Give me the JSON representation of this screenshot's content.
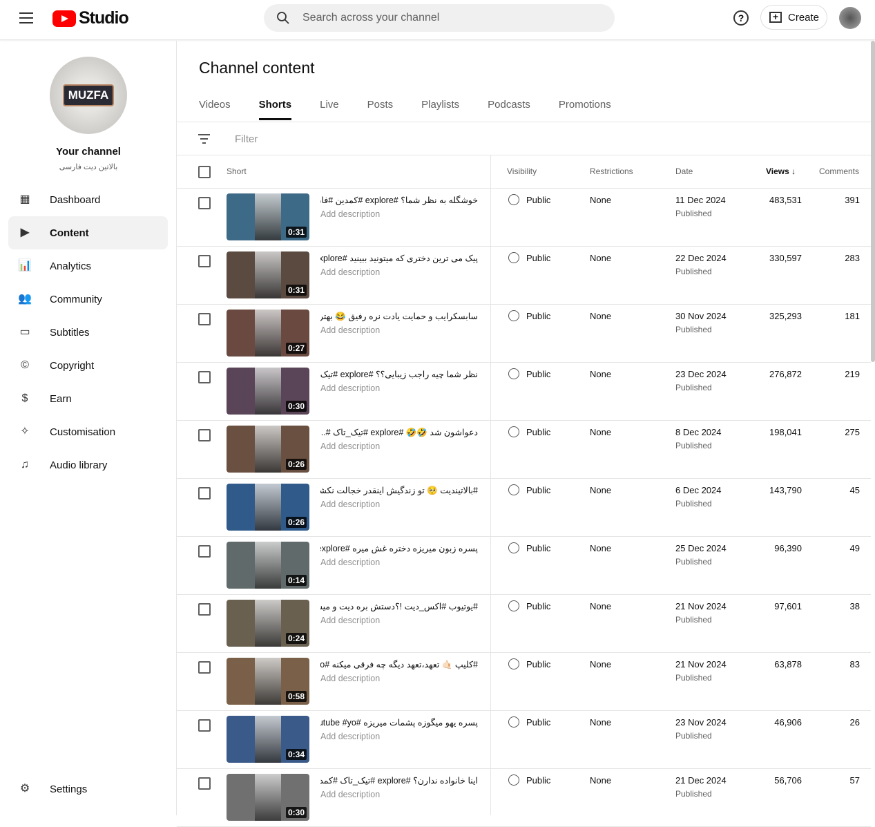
{
  "header": {
    "logo_text": "Studio",
    "search_placeholder": "Search across your channel",
    "help_label": "?",
    "create_label": "Create"
  },
  "sidebar": {
    "channel_title": "Your channel",
    "channel_name": "بالاتین دیت فارسی",
    "avatar_text": "MUZFA",
    "items": [
      {
        "label": "Dashboard",
        "icon": "dashboard-icon",
        "glyph": "▦"
      },
      {
        "label": "Content",
        "icon": "content-icon",
        "glyph": "▶",
        "active": true
      },
      {
        "label": "Analytics",
        "icon": "analytics-icon",
        "glyph": "📊"
      },
      {
        "label": "Community",
        "icon": "community-icon",
        "glyph": "👥"
      },
      {
        "label": "Subtitles",
        "icon": "subtitles-icon",
        "glyph": "▭"
      },
      {
        "label": "Copyright",
        "icon": "copyright-icon",
        "glyph": "©"
      },
      {
        "label": "Earn",
        "icon": "earn-icon",
        "glyph": "$"
      },
      {
        "label": "Customisation",
        "icon": "magic-wand-icon",
        "glyph": "✧"
      },
      {
        "label": "Audio library",
        "icon": "audio-library-icon",
        "glyph": "♫"
      }
    ],
    "settings_label": "Settings"
  },
  "main": {
    "title": "Channel content",
    "tabs": [
      "Videos",
      "Shorts",
      "Live",
      "Posts",
      "Playlists",
      "Podcasts",
      "Promotions"
    ],
    "active_tab": "Shorts",
    "filter_placeholder": "Filter",
    "columns": {
      "short": "Short",
      "visibility": "Visibility",
      "restrictions": "Restrictions",
      "date": "Date",
      "views": "Views",
      "views_sort": "↓",
      "comments": "Comments"
    },
    "rows": [
      {
        "title": "خوشگله به نظر شما؟ #explore #کمدین #فان ...",
        "duration": "0:31",
        "visibility": "Public",
        "restrictions": "None",
        "date": "11 Dec 2024",
        "status": "Published",
        "views": "483,531",
        "comments": "391",
        "color": "#3d6a86"
      },
      {
        "title": "پیک می ترین دختری که میتونید ببینید #explore ...",
        "duration": "0:31",
        "visibility": "Public",
        "restrictions": "None",
        "date": "22 Dec 2024",
        "status": "Published",
        "views": "330,597",
        "comments": "283",
        "color": "#5a4a40"
      },
      {
        "title": "سابسکرایب و حمایت یادت نره رفیق 😂 بهتر بود؟ ...",
        "duration": "0:27",
        "visibility": "Public",
        "restrictions": "None",
        "date": "30 Nov 2024",
        "status": "Published",
        "views": "325,293",
        "comments": "181",
        "color": "#6a4a40"
      },
      {
        "title": "نظر شما چیه راجب زیبایی؟؟ #explore #تیک_تاک...",
        "duration": "0:30",
        "visibility": "Public",
        "restrictions": "None",
        "date": "23 Dec 2024",
        "status": "Published",
        "views": "276,872",
        "comments": "219",
        "color": "#5a4458"
      },
      {
        "title": "دعواشون شد 🤣🤣 #explore #تیک_تاک #...",
        "duration": "0:26",
        "visibility": "Public",
        "restrictions": "None",
        "date": "8 Dec 2024",
        "status": "Published",
        "views": "198,041",
        "comments": "275",
        "color": "#6a5040"
      },
      {
        "title": "#بالاتیندیت 🥺 تو زندگیش اینقدر خجالت نکشیده بود...",
        "duration": "0:26",
        "visibility": "Public",
        "restrictions": "None",
        "date": "6 Dec 2024",
        "status": "Published",
        "views": "143,790",
        "comments": "45",
        "color": "#2f5a8a"
      },
      {
        "title": "پسره زبون میریزه دختره غش میره #explore #...",
        "duration": "0:14",
        "visibility": "Public",
        "restrictions": "None",
        "date": "25 Dec 2024",
        "status": "Published",
        "views": "96,390",
        "comments": "49",
        "color": "#606a6a"
      },
      {
        "title": "#یوتیوب #اکس_دیت !؟دستش بره دیت و میشه بخشید...",
        "duration": "0:24",
        "visibility": "Public",
        "restrictions": "None",
        "date": "21 Nov 2024",
        "status": "Published",
        "views": "97,601",
        "comments": "38",
        "color": "#6a6050"
      },
      {
        "title": "#کلیپ 🤙🏻 تعهد،تعهد دیگه چه فرقی میکنه #explo...",
        "duration": "0:58",
        "visibility": "Public",
        "restrictions": "None",
        "date": "21 Nov 2024",
        "status": "Published",
        "views": "63,878",
        "comments": "83",
        "color": "#7a6048"
      },
      {
        "title": "پسره یهو میگوزه پشمات میریزه #youtube #yo...",
        "duration": "0:34",
        "visibility": "Public",
        "restrictions": "None",
        "date": "23 Nov 2024",
        "status": "Published",
        "views": "46,906",
        "comments": "26",
        "color": "#3a5a8a"
      },
      {
        "title": "اینا خانواده ندارن؟ #explore #تیک_تاک #کمدین...",
        "duration": "0:30",
        "visibility": "Public",
        "restrictions": "None",
        "date": "21 Dec 2024",
        "status": "Published",
        "views": "56,706",
        "comments": "57",
        "color": "#707070"
      }
    ],
    "add_description": "Add description"
  }
}
